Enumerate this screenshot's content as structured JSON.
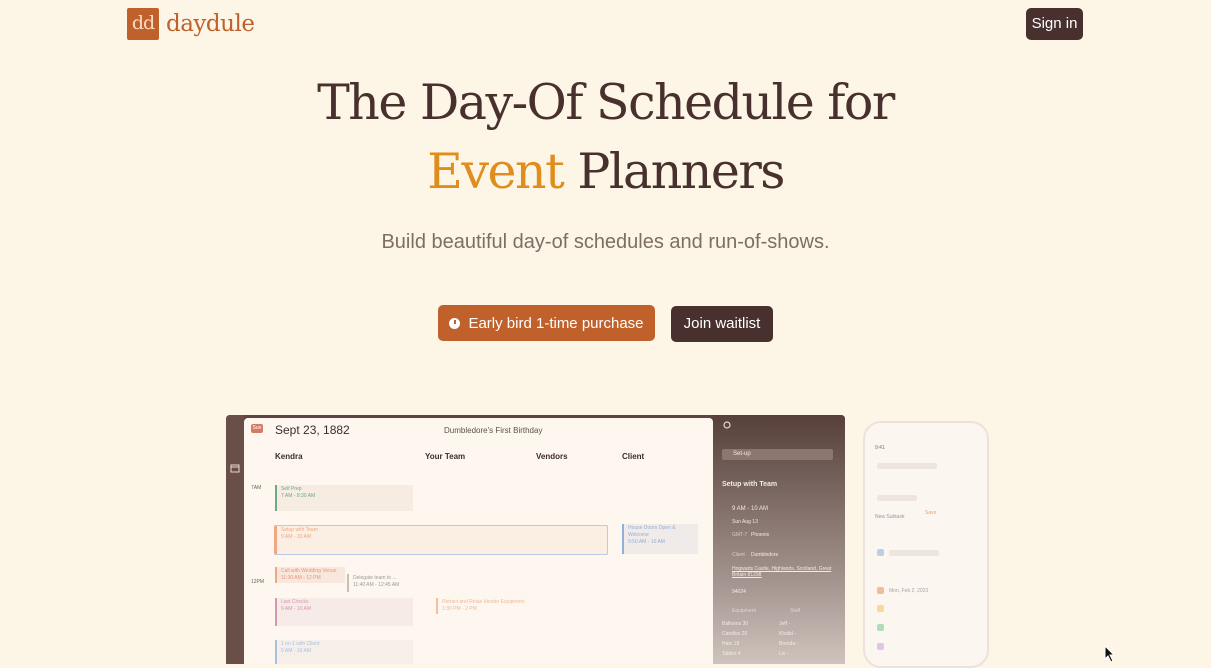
{
  "nav": {
    "logo_mark": "dd",
    "logo_text": "daydule",
    "signin_label": "Sign in"
  },
  "hero": {
    "title_line1": "The Day-Of Schedule for",
    "title_accent": "Event",
    "title_line2_rest": " Planners",
    "subtitle": "Build beautiful day-of schedules and run-of-shows.",
    "early_bird_label": "Early bird 1-time purchase",
    "waitlist_label": "Join waitlist"
  },
  "preview": {
    "day_badge": "Sun",
    "date": "Sept 23, 1882",
    "event_name": "Dumbledore's First Birthday",
    "columns": [
      "Kendra",
      "Your Team",
      "Vendors",
      "Client"
    ],
    "times": [
      "7AM",
      "12PM"
    ],
    "blocks": [
      {
        "title": "Self Prep",
        "time": "7 AM - 8:30 AM"
      },
      {
        "title": "Setup with Team",
        "time": "9 AM - 10 AM"
      },
      {
        "title": "House Doors Open & Welcome",
        "time": "9:50 AM - 10 AM"
      },
      {
        "title": "Call with Wedding Venue",
        "time": "11:30 AM - 12 PM"
      },
      {
        "title": "Delegate team to ...",
        "time": "11:40 AM - 12:45 AM"
      },
      {
        "title": "Last Checks",
        "time": "9 AM - 10 AM"
      },
      {
        "title": "Retract and Relax Vendor Equipment",
        "time": "1:30 PM - 2 PM"
      },
      {
        "title": "1 on 1 with Client",
        "time": "9 AM - 10 AM"
      }
    ],
    "side": {
      "tag": "Set-up",
      "heading": "Setup with Team",
      "time": "9 AM - 10 AM",
      "date": "Sun Aug 13",
      "tz_label": "GMT-7",
      "tz_value": "Phoenix",
      "client_label": "Client",
      "client_value": "Dumbledore",
      "address": "Hogwarts Castle, Highlands, Scotland, Great Britain 81298",
      "zip": "94024",
      "equipment_label": "Equipment",
      "staff_label": "Staff",
      "rows": [
        [
          "Balloons",
          "30",
          "Jeff",
          "-"
        ],
        [
          "Candles",
          "20",
          "Khalid",
          "-"
        ],
        [
          "Hats",
          "18",
          "Brenda",
          "-"
        ],
        [
          "Tables",
          "4",
          "Liv",
          "-"
        ]
      ]
    }
  },
  "phone": {
    "status_time": "9:41",
    "new_subtask": "New Subtask",
    "save": "Save",
    "date": "Mon, Feb 2, 2023"
  },
  "colors": {
    "brand": "#c0602b",
    "dark": "#47302d",
    "accent": "#df8d1c",
    "background": "#fdf5e6"
  }
}
